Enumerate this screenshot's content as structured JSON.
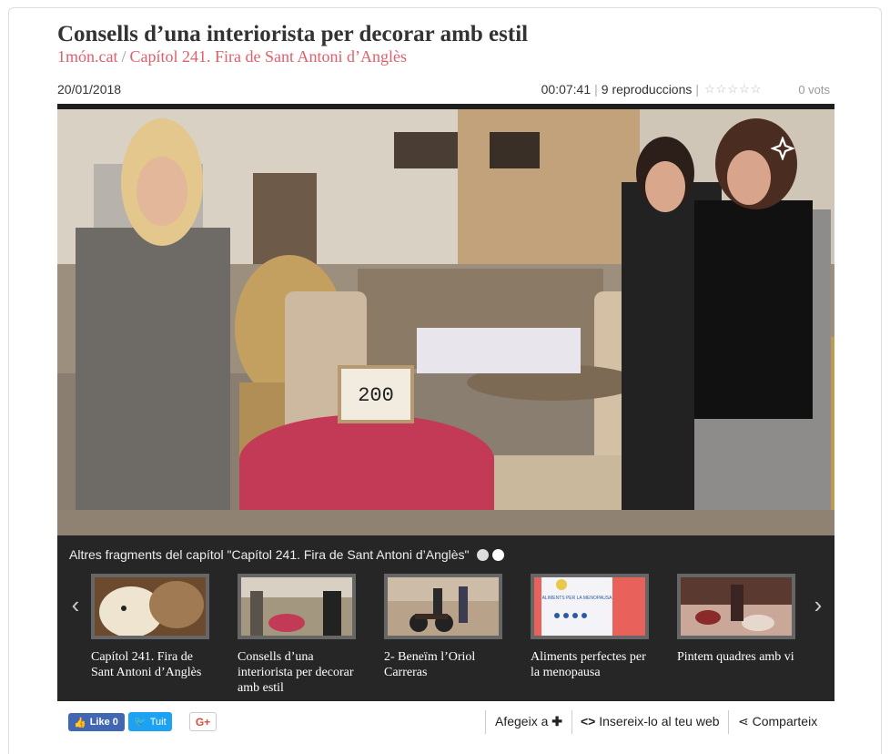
{
  "header": {
    "title": "Consells d’una interiorista per decorar amb estil",
    "channel": "1món.cat",
    "separator": "/",
    "episode": "Capítol 241. Fira de Sant Antoni d’Anglès"
  },
  "meta": {
    "date": "20/01/2018",
    "duration": "00:07:41",
    "plays": "9 reproduccions",
    "rating_stars": "☆☆☆☆☆",
    "votes": "0 vots"
  },
  "video": {
    "sign_text": "200"
  },
  "related": {
    "heading": "Altres fragments del capítol \"Capítol 241. Fira de Sant Antoni d’Anglès\"",
    "items": [
      {
        "caption": "Capítol 241. Fira de Sant Antoni d’Anglès"
      },
      {
        "caption": "Consells d’una interiorista per decorar amb estil"
      },
      {
        "caption": "2- Beneïm l’Oriol Carreras"
      },
      {
        "caption": "Aliments perfectes per la menopausa"
      },
      {
        "caption": "Pintem quadres amb vi"
      }
    ],
    "thumb4_text": "ALIMENTS PER LA MENOPAUSA"
  },
  "share": {
    "fb_label": "Like 0",
    "tw_label": "Tuit",
    "gp_label": "G+",
    "add_label": "Afegeix a",
    "embed_label": "Insereix-lo al teu web",
    "share_label": "Comparteix"
  },
  "colors": {
    "accent": "#e05f6a",
    "player_bg": "#1e1e1e",
    "facebook": "#4267b2",
    "twitter": "#1da1f2"
  }
}
